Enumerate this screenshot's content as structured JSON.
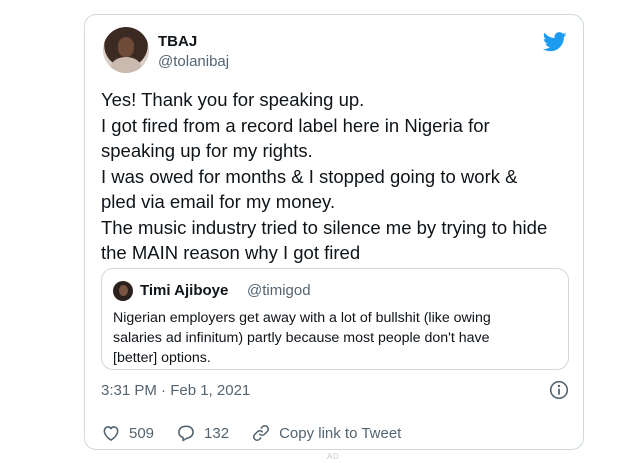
{
  "tweet": {
    "author_name": "TBAJ",
    "author_handle": "@tolanibaj",
    "lines": [
      "Yes! Thank you for speaking up.",
      "I got fired from a record label here in Nigeria for",
      "speaking up for my rights.",
      "I was owed for months & I stopped going to work &",
      "pled via email for my money.",
      "The music industry tried to silence me by trying to hide",
      "the MAIN reason why I got fired"
    ],
    "timestamp": "3:31 PM · Feb 1, 2021"
  },
  "quoted": {
    "author_name": "Timi Ajiboye",
    "author_handle": "@timigod",
    "lines": [
      "Nigerian employers get away with a lot of bullshit (like owing",
      "salaries ad infinitum) partly because most people don't have",
      "[better] options."
    ]
  },
  "actions": {
    "likes": "509",
    "replies": "132",
    "copy_link": "Copy link to Tweet"
  },
  "footer": {
    "ad_label": "AD"
  },
  "colors": {
    "twitter_blue": "#1d9bf0",
    "secondary_text": "#536471",
    "border": "#cfd9de"
  },
  "icons": [
    "twitter-bird-icon",
    "info-icon",
    "heart-icon",
    "reply-icon",
    "link-icon"
  ]
}
